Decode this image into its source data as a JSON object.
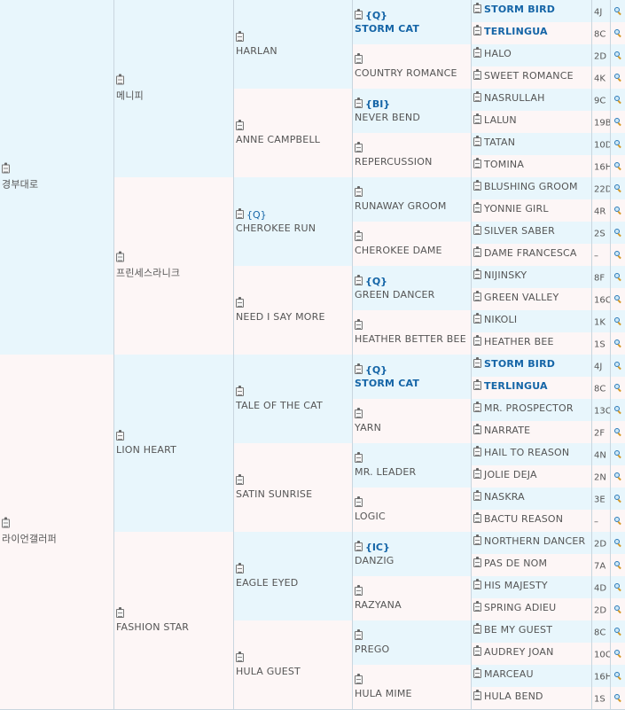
{
  "g1": [
    {
      "name": "경부대로"
    },
    {
      "name": "라이언갤러퍼"
    }
  ],
  "g2": [
    {
      "name": "메니피"
    },
    {
      "name": "프린세스라니크"
    },
    {
      "name": "LION HEART"
    },
    {
      "name": "FASHION STAR"
    }
  ],
  "g3": [
    {
      "name": "HARLAN"
    },
    {
      "name": "ANNE CAMPBELL"
    },
    {
      "name": "CHEROKEE RUN",
      "tag": "{Q}"
    },
    {
      "name": "NEED I SAY MORE"
    },
    {
      "name": "TALE OF THE CAT"
    },
    {
      "name": "SATIN SUNRISE"
    },
    {
      "name": "EAGLE EYED"
    },
    {
      "name": "HULA GUEST"
    }
  ],
  "g4": [
    {
      "name": "STORM CAT",
      "tag": "{Q}"
    },
    {
      "name": "COUNTRY ROMANCE"
    },
    {
      "name": "NEVER BEND",
      "tag": "{BI}"
    },
    {
      "name": "REPERCUSSION"
    },
    {
      "name": "RUNAWAY GROOM"
    },
    {
      "name": "CHEROKEE DAME"
    },
    {
      "name": "GREEN DANCER",
      "tag": "{Q}"
    },
    {
      "name": "HEATHER BETTER BEE"
    },
    {
      "name": "STORM CAT",
      "tag": "{Q}"
    },
    {
      "name": "YARN"
    },
    {
      "name": "MR. LEADER"
    },
    {
      "name": "LOGIC"
    },
    {
      "name": "DANZIG",
      "tag": "{IC}"
    },
    {
      "name": "RAZYANA"
    },
    {
      "name": "PREGO"
    },
    {
      "name": "HULA MIME"
    }
  ],
  "g5": [
    {
      "name": "STORM BIRD",
      "code": "4J"
    },
    {
      "name": "TERLINGUA",
      "code": "8C"
    },
    {
      "name": "HALO",
      "code": "2D"
    },
    {
      "name": "SWEET ROMANCE",
      "code": "4K"
    },
    {
      "name": "NASRULLAH",
      "code": "9C"
    },
    {
      "name": "LALUN",
      "code": "19B"
    },
    {
      "name": "TATAN",
      "code": "10D"
    },
    {
      "name": "TOMINA",
      "code": "16H"
    },
    {
      "name": "BLUSHING GROOM",
      "code": "22D"
    },
    {
      "name": "YONNIE GIRL",
      "code": "4R"
    },
    {
      "name": "SILVER SABER",
      "code": "2S"
    },
    {
      "name": "DAME FRANCESCA",
      "code": "–"
    },
    {
      "name": "NIJINSKY",
      "code": "8F"
    },
    {
      "name": "GREEN VALLEY",
      "code": "16C"
    },
    {
      "name": "NIKOLI",
      "code": "1K"
    },
    {
      "name": "HEATHER BEE",
      "code": "1S"
    },
    {
      "name": "STORM BIRD",
      "code": "4J"
    },
    {
      "name": "TERLINGUA",
      "code": "8C"
    },
    {
      "name": "MR. PROSPECTOR",
      "code": "13C"
    },
    {
      "name": "NARRATE",
      "code": "2F"
    },
    {
      "name": "HAIL TO REASON",
      "code": "4N"
    },
    {
      "name": "JOLIE DEJA",
      "code": "2N"
    },
    {
      "name": "NASKRA",
      "code": "3E"
    },
    {
      "name": "BACTU REASON",
      "code": "–"
    },
    {
      "name": "NORTHERN DANCER",
      "code": "2D"
    },
    {
      "name": "PAS DE NOM",
      "code": "7A"
    },
    {
      "name": "HIS MAJESTY",
      "code": "4D"
    },
    {
      "name": "SPRING ADIEU",
      "code": "2D"
    },
    {
      "name": "BE MY GUEST",
      "code": "8C"
    },
    {
      "name": "AUDREY JOAN",
      "code": "10C"
    },
    {
      "name": "MARCEAU",
      "code": "16H"
    },
    {
      "name": "HULA BEND",
      "code": "1S"
    }
  ],
  "bold_g5_indexes": [
    0,
    1,
    16,
    17
  ],
  "icons": {
    "doc": "clipboard-icon",
    "search": "magnifier-icon"
  },
  "colors": {
    "cell_blue": "#e8f6fc",
    "cell_pink": "#fdf6f6",
    "accent": "#1565a7",
    "border": "#c9d6df"
  }
}
